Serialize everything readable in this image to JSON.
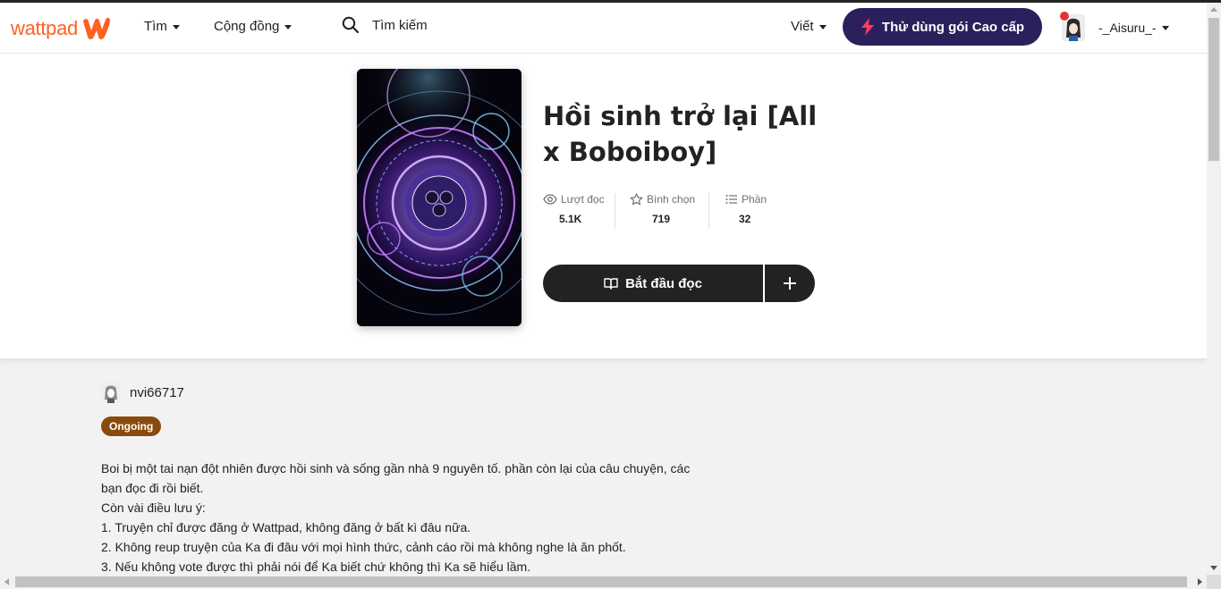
{
  "header": {
    "logo_text": "wattpad",
    "nav": {
      "browse": "Tìm",
      "community": "Cộng đồng"
    },
    "search": {
      "label": "Tìm kiếm"
    },
    "write": "Viết",
    "premium": "Thử dùng gói Cao cấp",
    "username": "-_Aisuru_-"
  },
  "story": {
    "title": "Hồi sinh trở lại [All x Boboiboy]",
    "stats": {
      "reads_label": "Lượt đọc",
      "reads_value": "5.1K",
      "votes_label": "Bình chọn",
      "votes_value": "719",
      "parts_label": "Phần",
      "parts_value": "32"
    },
    "start_reading": "Bắt đầu đọc",
    "author": "nvi66717",
    "status": "Ongoing",
    "description": [
      "Boi bị một tai nạn đột nhiên được hồi sinh và sống gần nhà 9 nguyên tố. phần còn lại của câu chuyện, các",
      "bạn đọc đi rồi biết.",
      "Còn vài điều lưu ý:",
      "1. Truyện chỉ được đăng ở Wattpad, không đăng ở bất kì đâu nữa.",
      "2. Không reup truyện của Ka đi đâu với mọi hình thức, cảnh cáo rồi mà không nghe là ăn phốt.",
      "3. Nếu không vote được thì phải nói để Ka biết chứ không thì Ka sẽ hiểu lầm."
    ]
  },
  "colors": {
    "brand": "#ff6122",
    "premium_bg": "#2b1f5c",
    "premium_icon": "#ff3c5a",
    "dark_button": "#222222",
    "status_badge": "#8a4a0c",
    "notification_dot": "#e5322d"
  }
}
